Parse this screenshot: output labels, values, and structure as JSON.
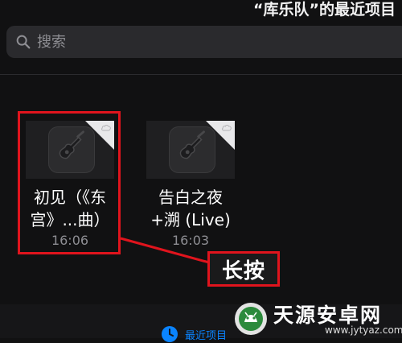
{
  "header": {
    "title": "“库乐队”的最近项目"
  },
  "search": {
    "placeholder": "搜索",
    "icon": "search-icon"
  },
  "files": [
    {
      "name_line1": "初见（《东",
      "name_line2": "宫》...曲）",
      "time": "16:06",
      "icon": "guitar-icon",
      "status_icon": "cloud-icon"
    },
    {
      "name_line1": "告白之夜",
      "name_line2": "+溯 (Live)",
      "time": "16:03",
      "icon": "guitar-icon",
      "status_icon": "cloud-icon"
    }
  ],
  "annotation": {
    "text": "长按",
    "color": "#e0141d"
  },
  "tabbar": {
    "recent_label": "最近项目",
    "icon": "clock-icon",
    "accent": "#0a84ff"
  },
  "watermark": {
    "name": "天源安卓网",
    "url": "www.jytyaz.com"
  }
}
